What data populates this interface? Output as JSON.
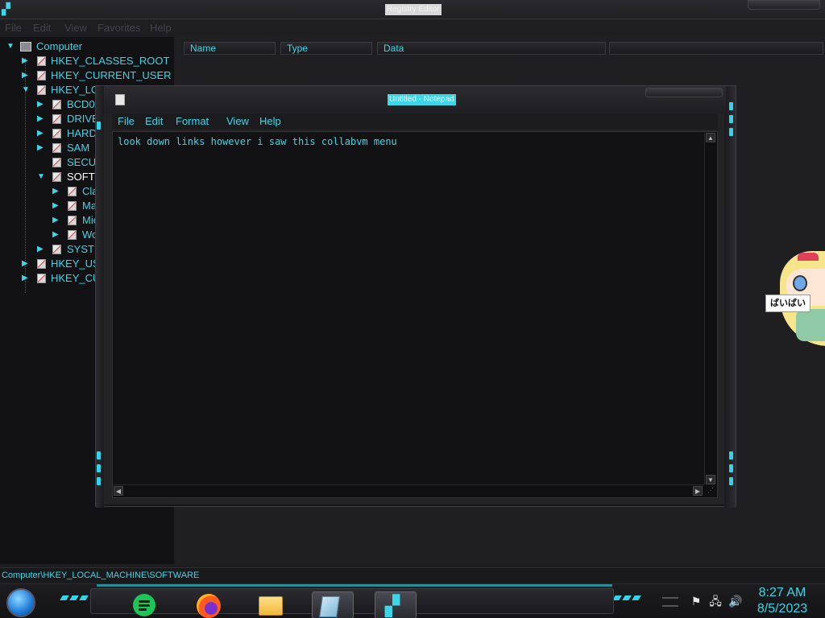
{
  "regedit": {
    "title": "Registry Editor",
    "menu": [
      "File",
      "Edit",
      "View",
      "Favorites",
      "Help"
    ],
    "columns": [
      "Name",
      "Type",
      "Data"
    ],
    "tree": {
      "root": "Computer",
      "hives": [
        "HKEY_CLASSES_ROOT",
        "HKEY_CURRENT_USER",
        "HKEY_LOCAL_MACHINE"
      ],
      "hklm_children": [
        "BCD0",
        "DRIVE",
        "HARD",
        "SAM",
        "SECUI",
        "SOFTV"
      ],
      "software_children": [
        "Cla",
        "Ma",
        "Mic",
        "Wo"
      ],
      "after_software": "SYSTE",
      "bottom_hives": [
        "HKEY_US",
        "HKEY_CU"
      ]
    },
    "status_path": "Computer\\HKEY_LOCAL_MACHINE\\SOFTWARE"
  },
  "notepad": {
    "title": "Untitled - Notepad",
    "menu": [
      "File",
      "Edit",
      "Format",
      "View",
      "Help"
    ],
    "content": "look down links however i saw this collabvm menu"
  },
  "desktop": {
    "mascot_tooltip": "ばいばい"
  },
  "taskbar": {
    "pinned": [
      "spotify-icon",
      "firefox-icon",
      "file-explorer-icon",
      "notepad-icon",
      "registry-editor-icon"
    ],
    "clock_time": "8:27 AM",
    "clock_date": "8/5/2023",
    "tray_icons": [
      "flag-icon",
      "network-icon",
      "volume-icon"
    ]
  },
  "colors": {
    "accent": "#3bd6e8",
    "window_bg": "#1e1e21",
    "editor_bg": "#121214"
  }
}
